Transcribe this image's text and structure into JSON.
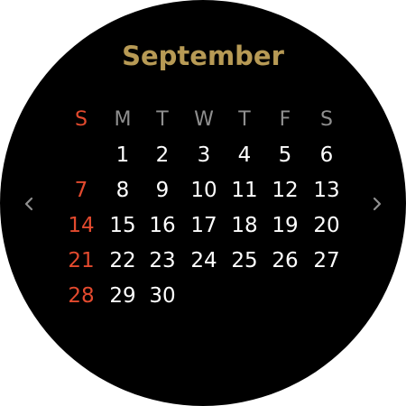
{
  "month": "September",
  "weekdays": [
    "S",
    "M",
    "T",
    "W",
    "T",
    "F",
    "S"
  ],
  "weeks": [
    [
      "",
      "1",
      "2",
      "3",
      "4",
      "5",
      "6"
    ],
    [
      "7",
      "8",
      "9",
      "10",
      "11",
      "12",
      "13"
    ],
    [
      "14",
      "15",
      "16",
      "17",
      "18",
      "19",
      "20"
    ],
    [
      "21",
      "22",
      "23",
      "24",
      "25",
      "26",
      "27"
    ],
    [
      "28",
      "29",
      "30",
      "",
      "",
      "",
      ""
    ]
  ],
  "colors": {
    "background": "#000000",
    "title": "#b79a55",
    "weekday_header": "#8f8f8f",
    "sunday": "#e34a2e",
    "day": "#ffffff",
    "nav_arrow": "#8f8f8f"
  },
  "icons": {
    "prev": "chevron-left-icon",
    "next": "chevron-right-icon"
  }
}
